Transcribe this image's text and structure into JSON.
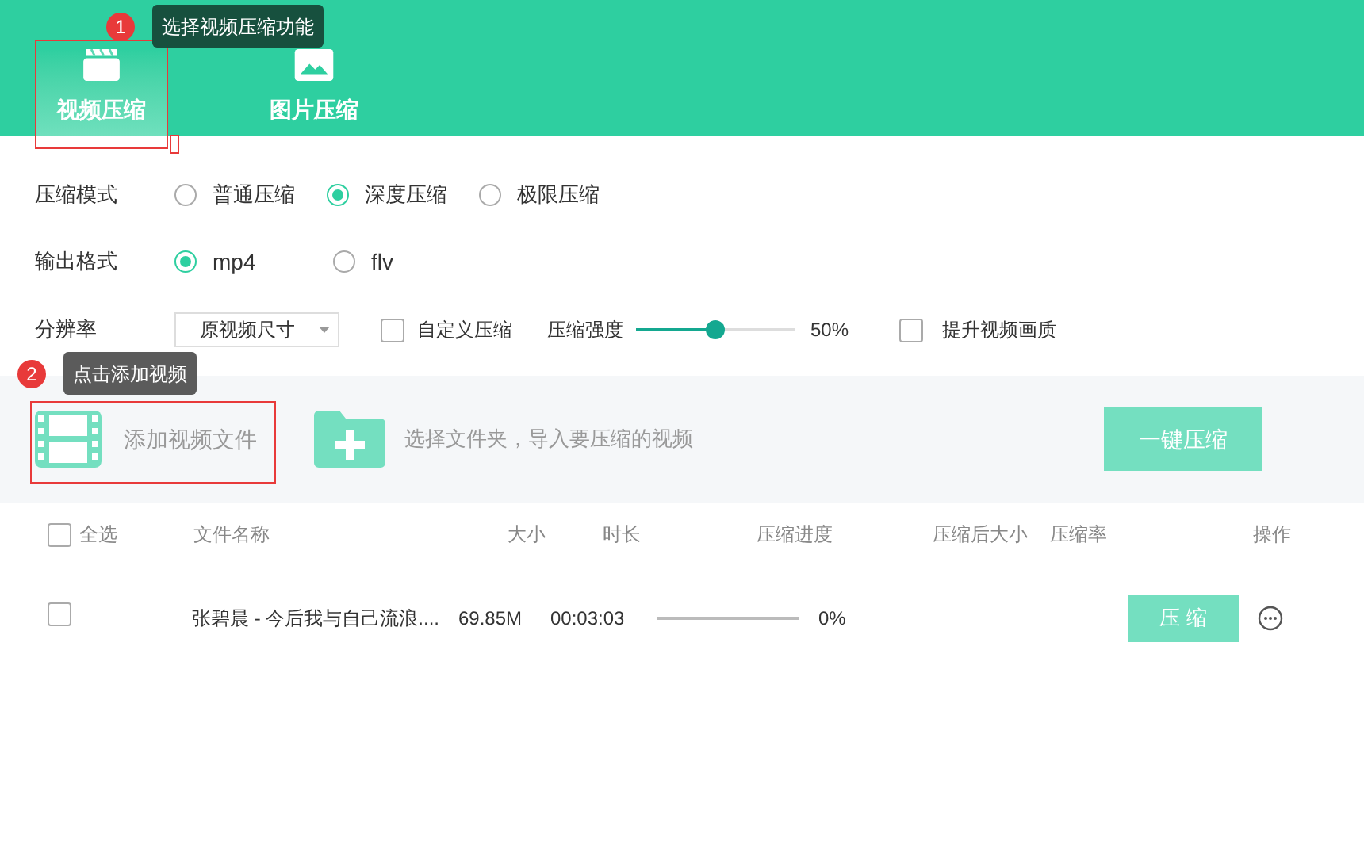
{
  "tabs": [
    {
      "label": "视频压缩",
      "kind": "video",
      "selected": true
    },
    {
      "label": "图片压缩",
      "kind": "image",
      "selected": false
    }
  ],
  "compress_mode": {
    "label": "压缩模式",
    "options": [
      {
        "label": "普通压缩",
        "selected": false
      },
      {
        "label": "深度压缩",
        "selected": true
      },
      {
        "label": "极限压缩",
        "selected": false
      }
    ]
  },
  "output_format": {
    "label": "输出格式",
    "options": [
      {
        "label": "mp4",
        "selected": true
      },
      {
        "label": "flv",
        "selected": false
      }
    ]
  },
  "resolution": {
    "label": "分辨率",
    "value": "原视频尺寸"
  },
  "custom_compress": {
    "label": "自定义压缩",
    "checked": false
  },
  "strength": {
    "label": "压缩强度",
    "level": 0.5,
    "reading": "50%"
  },
  "enhance_quality": {
    "label": "提升视频画质",
    "checked": false
  },
  "add_file": {
    "label": "添加视频文件"
  },
  "add_folder": {
    "label": "选择文件夹，导入要压缩的视频"
  },
  "compress_all_button": "一键压缩",
  "table": {
    "select_all": {
      "label": "全选",
      "checked": false
    },
    "columns": [
      "文件名称",
      "大小",
      "时长",
      "压缩进度",
      "压缩后大小",
      "压缩率",
      "操作"
    ],
    "rows": [
      {
        "checked": false,
        "name": "张碧晨 - 今后我与自己流浪....",
        "size": "69.85M",
        "duration": "00:03:03",
        "level": 0,
        "progress": "0%",
        "action": "压 缩"
      }
    ]
  },
  "annotations": [
    {
      "number": "1",
      "text": "选择视频压缩功能"
    },
    {
      "number": "2",
      "text": "点击添加视频"
    }
  ]
}
